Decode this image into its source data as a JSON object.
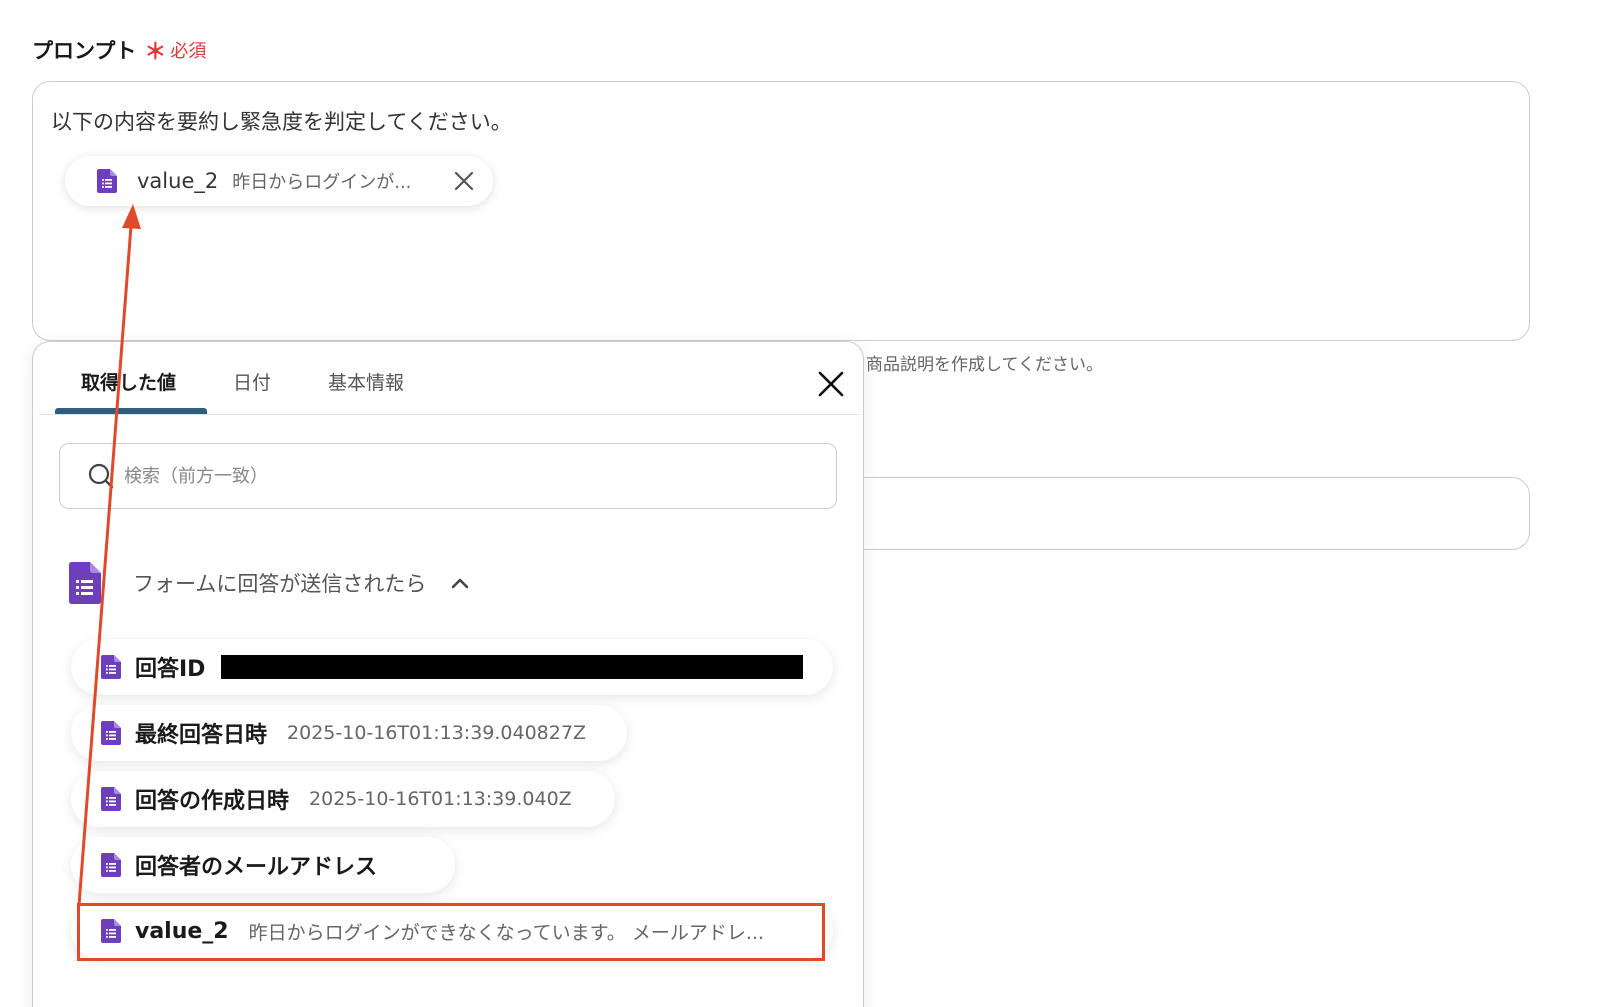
{
  "prompt": {
    "label": "プロンプト",
    "required_star": "＊",
    "required_text": "必須",
    "text": "以下の内容を要約し緊急度を判定してください。",
    "chip": {
      "name": "value_2",
      "preview": "昨日からログインが..."
    }
  },
  "background": {
    "helper_text": "商品説明を作成してください。"
  },
  "dropdown": {
    "tabs": [
      {
        "label": "取得した値",
        "active": true
      },
      {
        "label": "日付",
        "active": false
      },
      {
        "label": "基本情報",
        "active": false
      }
    ],
    "search": {
      "placeholder": "検索（前方一致）"
    },
    "group": {
      "title": "フォームに回答が送信されたら",
      "items": [
        {
          "name": "回答ID",
          "value": ""
        },
        {
          "name": "最終回答日時",
          "value": "2025-10-16T01:13:39.040827Z"
        },
        {
          "name": "回答の作成日時",
          "value": "2025-10-16T01:13:39.040Z"
        },
        {
          "name": "回答者のメールアドレス",
          "value": ""
        },
        {
          "name": "value_2",
          "value": "昨日からログインができなくなっています。 メールアドレ..."
        }
      ]
    }
  },
  "colors": {
    "required": "#e0373d",
    "form_icon": "#6e3fba",
    "tab_underline": "#2d5f7c",
    "highlight": "#e04a2a"
  }
}
